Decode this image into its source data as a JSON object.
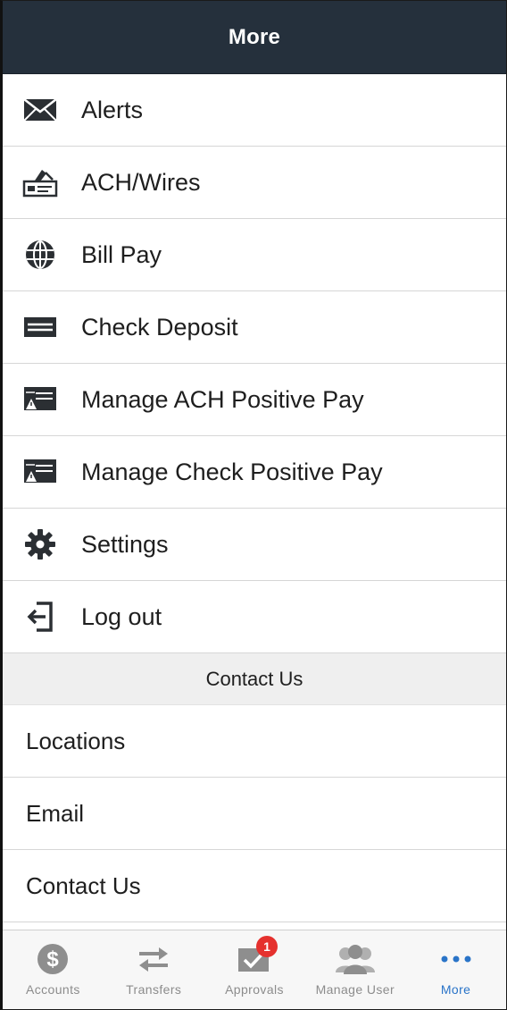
{
  "header": {
    "title": "More"
  },
  "menu": [
    {
      "label": "Alerts",
      "icon": "envelope-icon"
    },
    {
      "label": "ACH/Wires",
      "icon": "check-transfer-icon"
    },
    {
      "label": "Bill Pay",
      "icon": "globe-icon"
    },
    {
      "label": "Check Deposit",
      "icon": "check-deposit-icon"
    },
    {
      "label": "Manage ACH Positive Pay",
      "icon": "positive-pay-icon"
    },
    {
      "label": "Manage Check Positive Pay",
      "icon": "positive-pay-icon"
    },
    {
      "label": "Settings",
      "icon": "gear-icon"
    },
    {
      "label": "Log out",
      "icon": "logout-icon"
    }
  ],
  "contact_section": {
    "header": "Contact Us",
    "items": [
      "Locations",
      "Email",
      "Contact Us"
    ]
  },
  "tabbar": {
    "tabs": [
      {
        "label": "Accounts",
        "icon": "dollar-icon"
      },
      {
        "label": "Transfers",
        "icon": "transfer-arrows-icon"
      },
      {
        "label": "Approvals",
        "icon": "approval-check-icon",
        "badge": "1"
      },
      {
        "label": "Manage User",
        "icon": "users-icon"
      },
      {
        "label": "More",
        "icon": "more-dots-icon",
        "active": true
      }
    ]
  },
  "colors": {
    "header_bg": "#25303c",
    "active_tab": "#2a74c8",
    "badge": "#e5312e",
    "section_bg": "#efefef"
  }
}
